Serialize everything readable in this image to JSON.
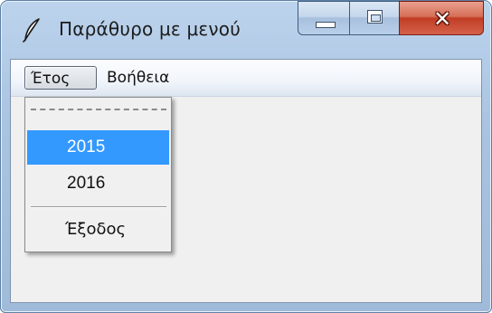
{
  "window": {
    "title": "Παράθυρο με μενού",
    "icon": "feather-icon",
    "caption_buttons": {
      "minimize": "minimize-icon",
      "maximize": "maximize-icon",
      "close": "close-icon"
    }
  },
  "menubar": {
    "items": [
      {
        "label": "Έτος",
        "state": "open"
      },
      {
        "label": "Βοήθεια"
      }
    ]
  },
  "dropdown": {
    "tearoff": "- - - - - - -",
    "items": [
      {
        "label": "2015",
        "highlighted": true
      },
      {
        "label": "2016"
      },
      {
        "label": "Έξοδος"
      }
    ],
    "highlight_color": "#3399ff"
  }
}
